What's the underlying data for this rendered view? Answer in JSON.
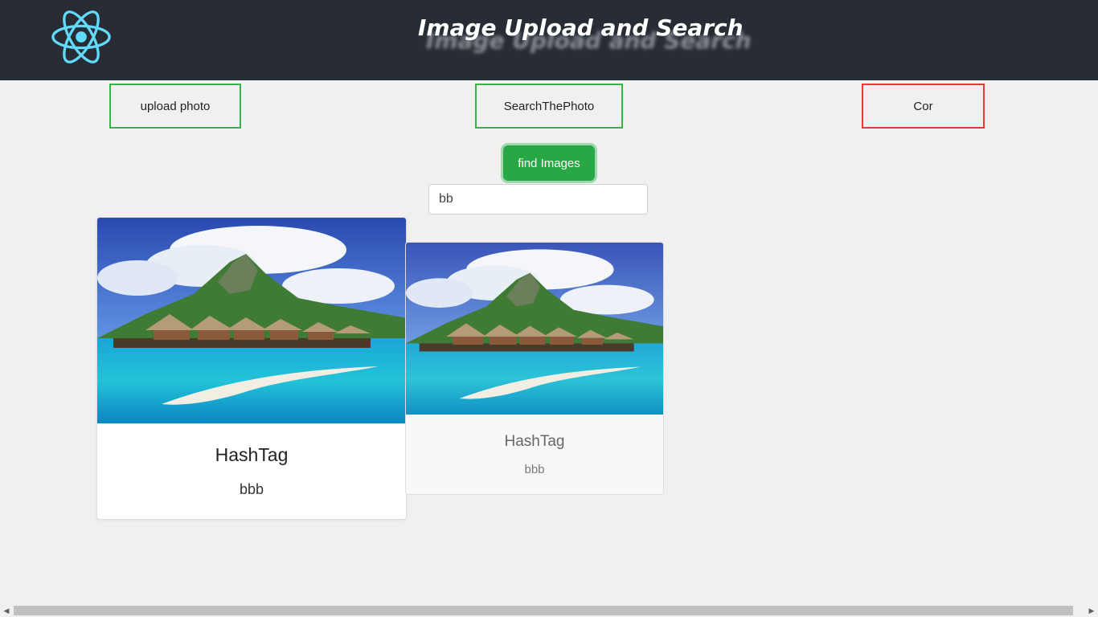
{
  "header": {
    "title": "Image Upload and Search",
    "logo_icon": "react-atom-icon"
  },
  "nav": {
    "upload_label": "upload photo",
    "search_label": "SearchThePhoto",
    "cor_label": "Cor"
  },
  "search": {
    "button_label": "find Images",
    "value": "bb"
  },
  "results": [
    {
      "title": "HashTag",
      "text": "bbb"
    },
    {
      "title": "HashTag",
      "text": "bbb"
    }
  ],
  "colors": {
    "header_bg": "#282c34",
    "accent_green": "#28a745",
    "nav_border_green": "#3cb04a",
    "nav_border_red": "#e53935",
    "react_blue": "#61dafb"
  }
}
